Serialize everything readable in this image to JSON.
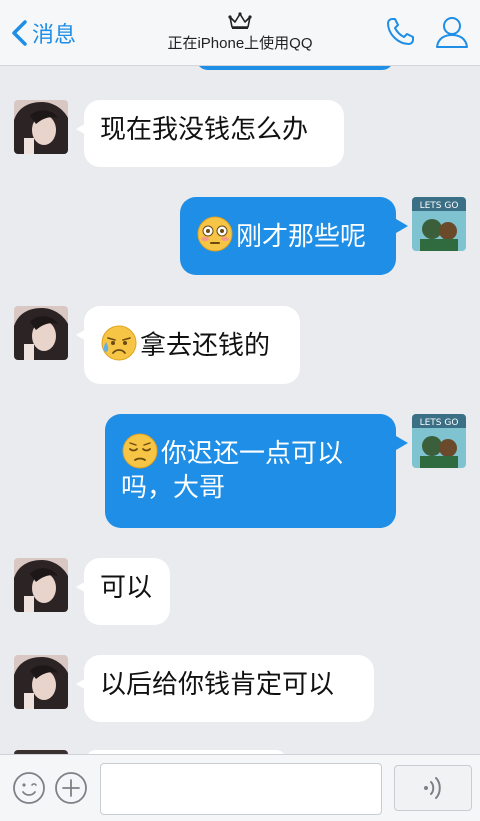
{
  "header": {
    "back_label": "消息",
    "status_text": "正在iPhone上使用QQ"
  },
  "colors": {
    "accent": "#1e8ee6",
    "background": "#e9ebee",
    "incoming_bubble": "#ffffff"
  },
  "messages": [
    {
      "direction": "incoming",
      "text": "现在我没钱怎么办",
      "emoji": null
    },
    {
      "direction": "outgoing",
      "text": "刚才那些呢",
      "emoji": "flushed-face-emoji"
    },
    {
      "direction": "incoming",
      "text": "拿去还钱的",
      "emoji": "sad-sweat-face-emoji"
    },
    {
      "direction": "outgoing",
      "text_line1": "你迟还一点可以",
      "text_line2": "吗，大哥",
      "emoji": "pensive-face-emoji"
    },
    {
      "direction": "incoming",
      "text": "可以",
      "emoji": null
    },
    {
      "direction": "incoming",
      "text": "以后给你钱肯定可以",
      "emoji": null
    }
  ],
  "inputbar": {
    "text_value": "",
    "icons": [
      "emoji-icon",
      "plus-icon",
      "voice-icon"
    ]
  }
}
